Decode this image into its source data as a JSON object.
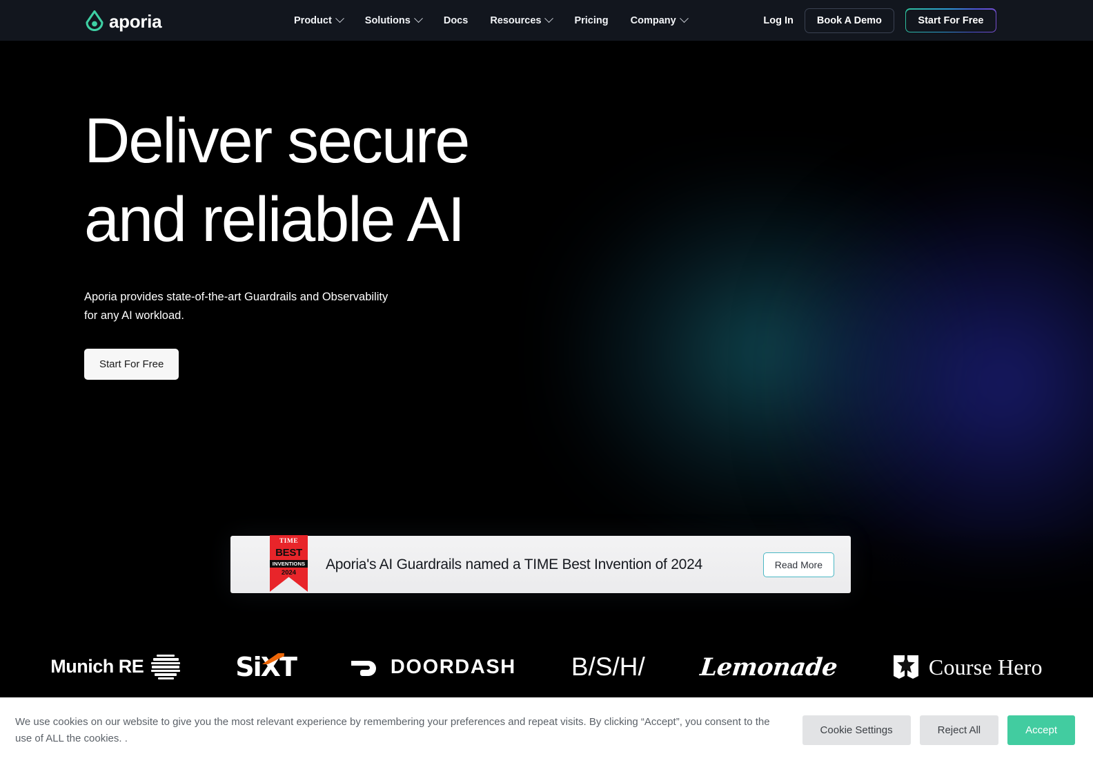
{
  "navbar": {
    "logo": {
      "icon": "aporia-droplet-logo-icon",
      "word": "aporia",
      "color": "#3ecfa3"
    },
    "links": [
      {
        "label": "Product",
        "has_dropdown": true
      },
      {
        "label": "Solutions",
        "has_dropdown": true
      },
      {
        "label": "Docs",
        "has_dropdown": false
      },
      {
        "label": "Resources",
        "has_dropdown": true
      },
      {
        "label": "Pricing",
        "has_dropdown": false
      },
      {
        "label": "Company",
        "has_dropdown": true
      }
    ],
    "login_label": "Log In",
    "demo_label": "Book A Demo",
    "start_label": "Start For Free"
  },
  "hero": {
    "title": "Deliver secure\nand reliable AI",
    "subtitle": "Aporia provides state-of-the-art Guardrails and Observability\nfor any AI workload.",
    "cta_label": "Start For Free"
  },
  "time_banner": {
    "badge": {
      "time": "TIME",
      "best": "BEST",
      "inventions": "INVENTIONS",
      "year": "2024",
      "color": "#e8252a"
    },
    "headline": "Aporia's AI Guardrails named a TIME Best Invention of 2024",
    "read_more_label": "Read More"
  },
  "logos": [
    {
      "name": "munich-re",
      "text": "Munich RE"
    },
    {
      "name": "sixt",
      "text": "SiXT"
    },
    {
      "name": "doordash",
      "text": "DOORDASH"
    },
    {
      "name": "bsh",
      "text": "B/S/H/"
    },
    {
      "name": "lemonade",
      "text": "Lemonade"
    },
    {
      "name": "course-hero",
      "text": "Course Hero"
    }
  ],
  "cookie_banner": {
    "text": "We use cookies on our website to give you the most relevant experience by remembering your preferences and repeat visits. By clicking “Accept”, you consent to the use of ALL the cookies. .",
    "settings_label": "Cookie Settings",
    "reject_label": "Reject All",
    "accept_label": "Accept",
    "accept_color": "#42cca0"
  }
}
